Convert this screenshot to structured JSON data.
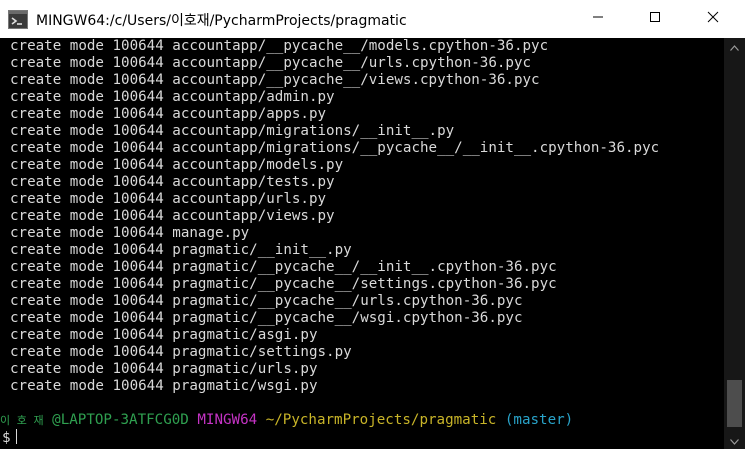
{
  "window": {
    "title": "MINGW64:/c/Users/이호재/PycharmProjects/pragmatic",
    "controls": [
      "minimize",
      "maximize",
      "close"
    ]
  },
  "terminal": {
    "output_lines": [
      "create mode 100644 accountapp/__pycache__/models.cpython-36.pyc",
      "create mode 100644 accountapp/__pycache__/urls.cpython-36.pyc",
      "create mode 100644 accountapp/__pycache__/views.cpython-36.pyc",
      "create mode 100644 accountapp/admin.py",
      "create mode 100644 accountapp/apps.py",
      "create mode 100644 accountapp/migrations/__init__.py",
      "create mode 100644 accountapp/migrations/__pycache__/__init__.cpython-36.pyc",
      "create mode 100644 accountapp/models.py",
      "create mode 100644 accountapp/tests.py",
      "create mode 100644 accountapp/urls.py",
      "create mode 100644 accountapp/views.py",
      "create mode 100644 manage.py",
      "create mode 100644 pragmatic/__init__.py",
      "create mode 100644 pragmatic/__pycache__/__init__.cpython-36.pyc",
      "create mode 100644 pragmatic/__pycache__/settings.cpython-36.pyc",
      "create mode 100644 pragmatic/__pycache__/urls.cpython-36.pyc",
      "create mode 100644 pragmatic/__pycache__/wsgi.cpython-36.pyc",
      "create mode 100644 pragmatic/asgi.py",
      "create mode 100644 pragmatic/settings.py",
      "create mode 100644 pragmatic/urls.py",
      "create mode 100644 pragmatic/wsgi.py"
    ],
    "prompt": {
      "user": "이 호 재",
      "host": "@LAPTOP-3ATFCG0D",
      "system": "MINGW64",
      "path": "~/PycharmProjects/pragmatic",
      "branch": "(master)",
      "symbol": "$"
    }
  },
  "colors": {
    "background": "#000000",
    "text": "#d9d9d9",
    "user_host": "#2fa050",
    "system": "#c533c5",
    "path": "#c8b428",
    "branch": "#29a3c9"
  },
  "icons": {
    "app": "mingw-terminal-icon",
    "minimize": "minimize-icon",
    "maximize": "maximize-icon",
    "close": "close-icon",
    "scroll_up": "scroll-up-arrow-icon",
    "scroll_down": "scroll-down-arrow-icon"
  }
}
